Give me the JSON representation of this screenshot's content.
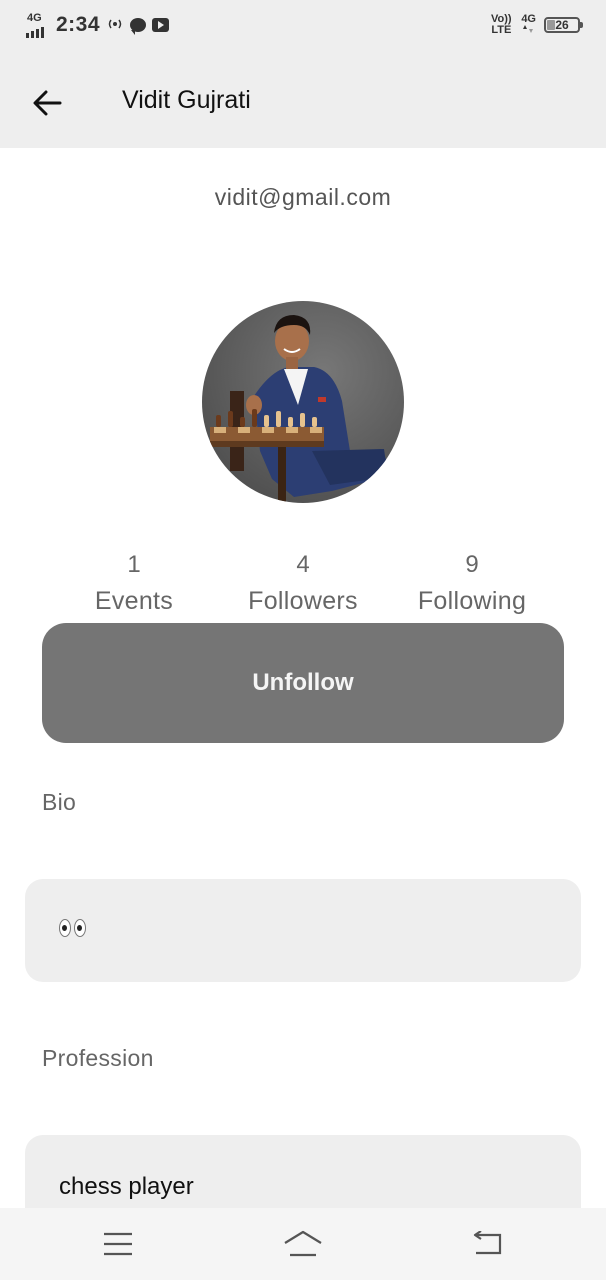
{
  "status_bar": {
    "network_type": "4G",
    "time": "2:34",
    "volte": "Vo)) LTE",
    "data_type": "4G",
    "battery_level": "26",
    "battery_fraction": 0.26,
    "icons": [
      "signal-icon",
      "hotspot-icon",
      "chat-icon",
      "youtube-icon",
      "battery-icon"
    ]
  },
  "app_bar": {
    "title": "Vidit Gujrati",
    "back_icon": "arrow-left-icon"
  },
  "profile": {
    "email": "vidit@gmail.com",
    "avatar": "profile-photo"
  },
  "stats": [
    {
      "value": "1",
      "label": "Events"
    },
    {
      "value": "4",
      "label": "Followers"
    },
    {
      "value": "9",
      "label": "Following"
    }
  ],
  "actions": {
    "unfollow_label": "Unfollow"
  },
  "bio": {
    "label": "Bio",
    "value_icon": "eyes-emoji"
  },
  "profession": {
    "label": "Profession",
    "value": "chess player"
  },
  "nav_bar": {
    "icons": [
      "menu-icon",
      "home-icon",
      "back-icon"
    ]
  },
  "colors": {
    "bar_background": "#eeeeee",
    "button_background": "#757575",
    "field_background": "#eeeeee",
    "text_secondary": "#666666"
  }
}
